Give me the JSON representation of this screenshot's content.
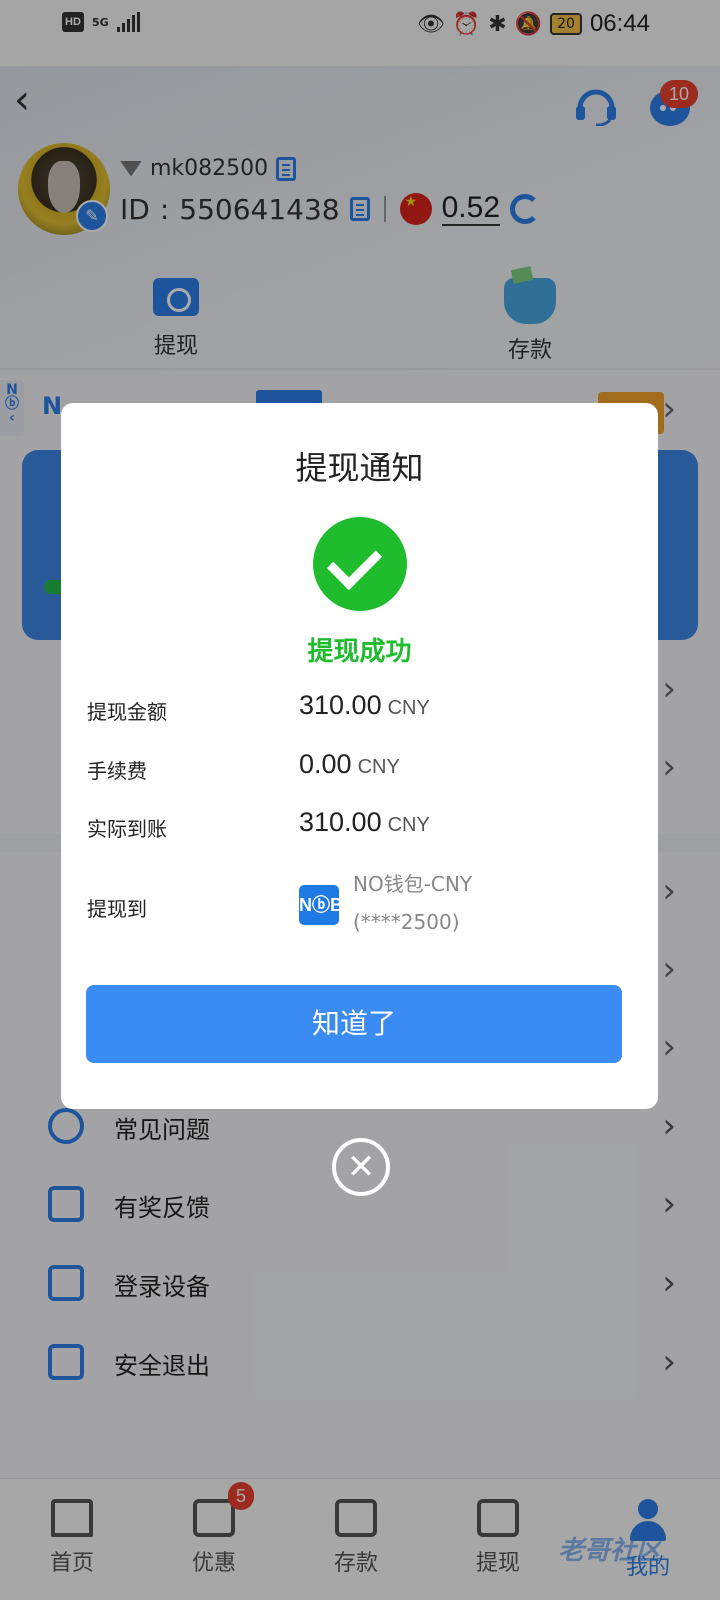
{
  "status_bar": {
    "network": "HD",
    "signal": "5G",
    "battery": "20",
    "time": "06:44"
  },
  "header": {
    "message_badge": "10"
  },
  "profile": {
    "username": "mk082500",
    "id_label": "ID",
    "id_value": "550641438",
    "balance": "0.52"
  },
  "quick_actions": [
    {
      "label": "提现",
      "icon": "withdraw-icon"
    },
    {
      "label": "存款",
      "icon": "wallet-purse-icon"
    }
  ],
  "menu": [
    {
      "label": "常见问题",
      "icon": "question-icon"
    },
    {
      "label": "有奖反馈",
      "icon": "edit-icon"
    },
    {
      "label": "登录设备",
      "icon": "devices-icon"
    },
    {
      "label": "安全退出",
      "icon": "logout-icon"
    }
  ],
  "tabbar": {
    "tabs": [
      {
        "label": "首页"
      },
      {
        "label": "优惠",
        "badge": "5"
      },
      {
        "label": "存款"
      },
      {
        "label": "提现"
      },
      {
        "label": "我的"
      }
    ],
    "active": "我的"
  },
  "watermark": "老哥社区",
  "modal": {
    "title": "提现通知",
    "status": "提现成功",
    "rows": [
      {
        "label": "提现金额",
        "value": "310.00",
        "unit": "CNY"
      },
      {
        "label": "手续费",
        "value": "0.00",
        "unit": "CNY"
      },
      {
        "label": "实际到账",
        "value": "310.00",
        "unit": "CNY"
      }
    ],
    "destination": {
      "label": "提现到",
      "logo_text": "NⓑB",
      "wallet_name": "NO钱包-CNY",
      "wallet_account": "(****2500)"
    },
    "confirm_label": "知道了"
  },
  "colors": {
    "accent": "#3b8bf4",
    "success": "#1fbd2d",
    "badge": "#e8412f"
  }
}
